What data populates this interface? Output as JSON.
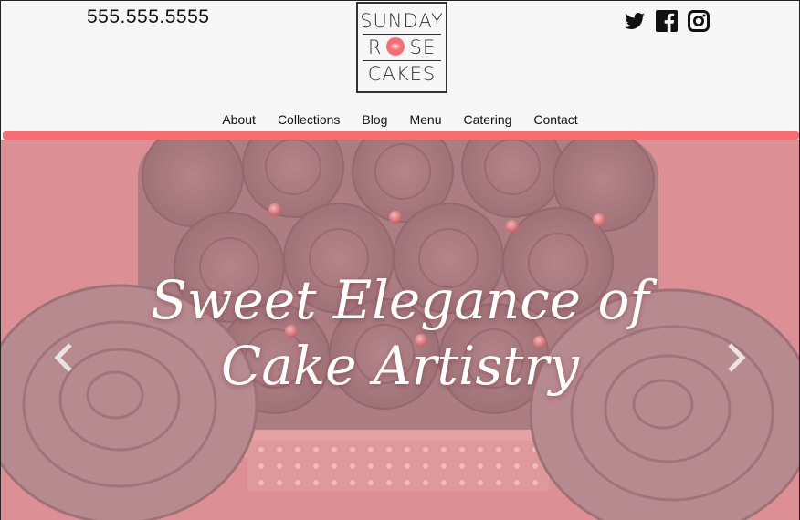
{
  "header": {
    "phone": "555.555.5555",
    "logo": {
      "line1": "SUNDAY",
      "line2_left": "R",
      "line2_right": "SE",
      "line3": "CAKES"
    },
    "social": [
      {
        "icon": "twitter-icon"
      },
      {
        "icon": "facebook-icon"
      },
      {
        "icon": "instagram-icon"
      }
    ]
  },
  "nav": {
    "items": [
      {
        "label": "About"
      },
      {
        "label": "Collections"
      },
      {
        "label": "Blog"
      },
      {
        "label": "Menu"
      },
      {
        "label": "Catering"
      },
      {
        "label": "Contact"
      }
    ]
  },
  "hero": {
    "title_line1": "Sweet Elegance of",
    "title_line2": "Cake Artistry",
    "prev_icon": "chevron-left-icon",
    "next_icon": "chevron-right-icon"
  },
  "colors": {
    "accent": "#f46e72",
    "hero_tint": "#d88f93",
    "header_bg": "#f7f7f7"
  }
}
